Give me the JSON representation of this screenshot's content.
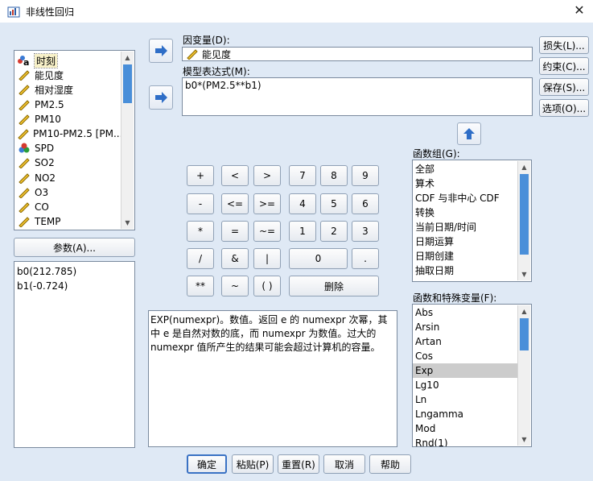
{
  "window": {
    "title": "非线性回归"
  },
  "variables": [
    {
      "label": "时刻",
      "icon": "nominal-string-icon",
      "selected": true
    },
    {
      "label": "能见度",
      "icon": "scale-ruler-icon"
    },
    {
      "label": "相对湿度",
      "icon": "scale-ruler-icon"
    },
    {
      "label": "PM2.5",
      "icon": "scale-ruler-icon"
    },
    {
      "label": "PM10",
      "icon": "scale-ruler-icon"
    },
    {
      "label": "PM10-PM2.5 [PM...",
      "icon": "scale-ruler-icon"
    },
    {
      "label": "SPD",
      "icon": "nominal-balls-icon"
    },
    {
      "label": "SO2",
      "icon": "scale-ruler-icon"
    },
    {
      "label": "NO2",
      "icon": "scale-ruler-icon"
    },
    {
      "label": "O3",
      "icon": "scale-ruler-icon"
    },
    {
      "label": "CO",
      "icon": "scale-ruler-icon"
    },
    {
      "label": "TEMP",
      "icon": "scale-ruler-icon"
    }
  ],
  "params_button": "参数(A)...",
  "params": [
    "b0(212.785)",
    "b1(-0.724)"
  ],
  "dependent": {
    "label": "因变量(D):",
    "value": "能见度"
  },
  "model": {
    "label": "模型表达式(M):",
    "value": "b0*(PM2.5**b1)"
  },
  "calculator": {
    "row1": [
      "+",
      "<",
      ">",
      "7",
      "8",
      "9"
    ],
    "row2": [
      "-",
      "<=",
      ">=",
      "4",
      "5",
      "6"
    ],
    "row3": [
      "*",
      "=",
      "~=",
      "1",
      "2",
      "3"
    ],
    "row4": [
      "/",
      "&",
      "|",
      "0",
      "."
    ],
    "row5": [
      "**",
      "~",
      "( )",
      "删除"
    ]
  },
  "description": "EXP(numexpr)。数值。返回 e 的 numexpr 次幂，其中 e 是自然对数的底，而 numexpr 为数值。过大的 numexpr 值所产生的结果可能会超过计算机的容量。",
  "function_group": {
    "label": "函数组(G):",
    "items": [
      "全部",
      "算术",
      "CDF 与非中心 CDF",
      "转换",
      "当前日期/时间",
      "日期运算",
      "日期创建",
      "抽取日期"
    ]
  },
  "functions": {
    "label": "函数和特殊变量(F):",
    "items": [
      "Abs",
      "Arsin",
      "Artan",
      "Cos",
      "Exp",
      "Lg10",
      "Ln",
      "Lngamma",
      "Mod",
      "Rnd(1)"
    ],
    "selected": "Exp"
  },
  "side_buttons": [
    "损失(L)...",
    "约束(C)...",
    "保存(S)...",
    "选项(O)..."
  ],
  "bottom_buttons": [
    "确定",
    "粘贴(P)",
    "重置(R)",
    "取消",
    "帮助"
  ],
  "colors": {
    "background": "#dfe9f5",
    "accent_arrow": "#2f6ec7",
    "scroll_thumb": "#4a8fd9"
  }
}
